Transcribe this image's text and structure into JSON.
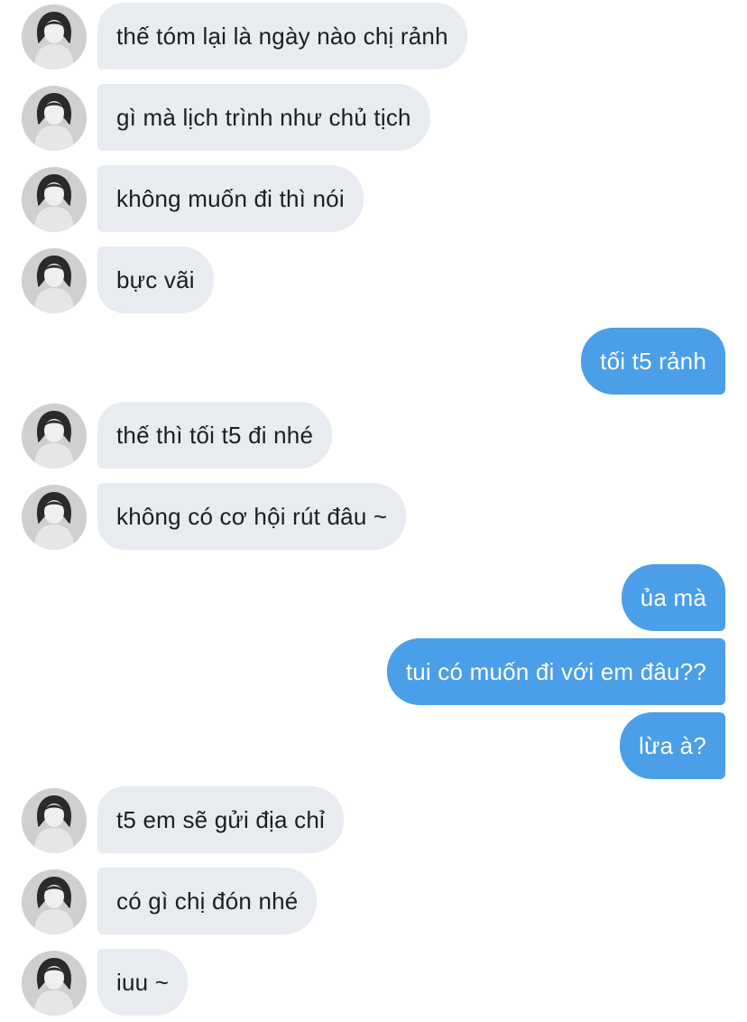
{
  "conversation": {
    "messages": [
      {
        "sender": "them",
        "text": "thế tóm lại là ngày nào chị rảnh"
      },
      {
        "sender": "them",
        "text": "gì mà lịch trình như chủ tịch"
      },
      {
        "sender": "them",
        "text": "không muốn đi thì nói"
      },
      {
        "sender": "them",
        "text": "bực vãi"
      },
      {
        "sender": "me",
        "text": "tối t5 rảnh"
      },
      {
        "sender": "them",
        "text": "thế thì tối t5 đi nhé"
      },
      {
        "sender": "them",
        "text": "không có cơ hội rút đâu ~"
      },
      {
        "sender": "me",
        "text": "ủa mà"
      },
      {
        "sender": "me",
        "text": "tui có muốn đi với em đâu??"
      },
      {
        "sender": "me",
        "text": "lừa à?"
      },
      {
        "sender": "them",
        "text": "t5 em sẽ gửi địa chỉ"
      },
      {
        "sender": "them",
        "text": "có gì chị đón nhé"
      },
      {
        "sender": "them",
        "text": "iuu ~"
      }
    ]
  },
  "colors": {
    "incoming_bubble": "#e8ebef",
    "outgoing_bubble": "#4b9ee8",
    "incoming_text": "#1c1e21",
    "outgoing_text": "#ffffff"
  }
}
